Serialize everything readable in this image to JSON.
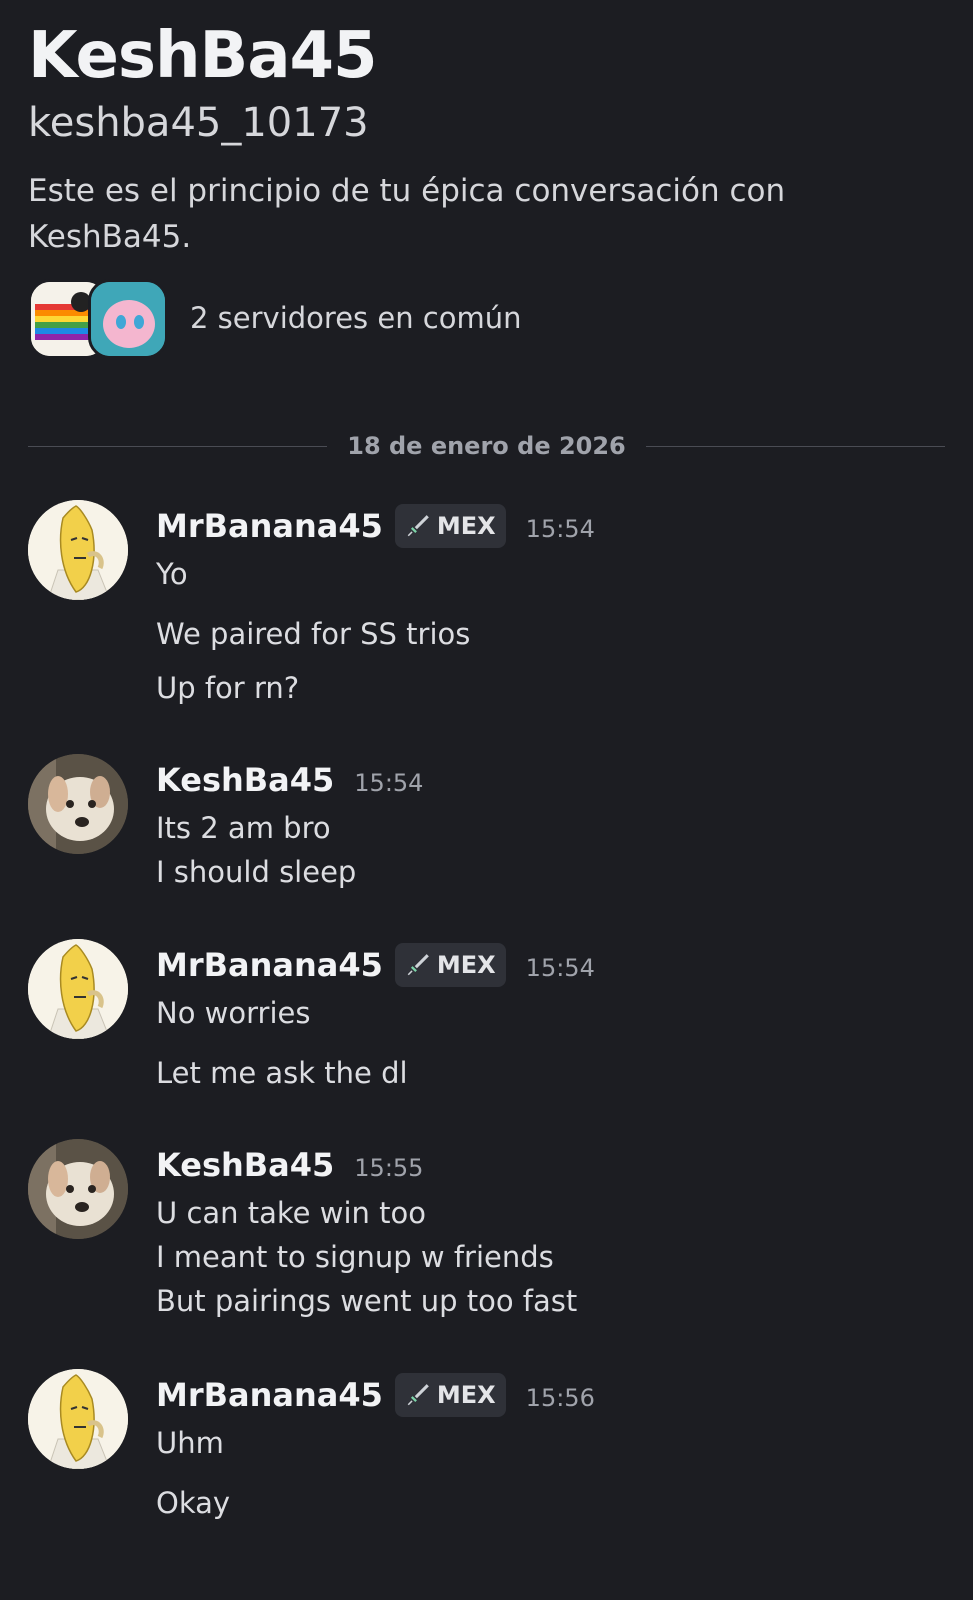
{
  "profile": {
    "display_name": "KeshBa45",
    "username": "keshba45_10173",
    "intro": "Este es el principio de tu épica conversación con KeshBa45.",
    "mutual_servers": "2 servidores en común"
  },
  "date_divider": "18 de enero de 2026",
  "tag_icon": "sword-icon",
  "messages": [
    {
      "author": "MrBanana45",
      "tag": "MEX",
      "time": "15:54",
      "lines": [
        "Yo",
        "We paired for SS trios",
        "Up for rn?"
      ]
    },
    {
      "author": "KeshBa45",
      "time": "15:54",
      "lines": [
        "Its 2 am bro",
        "I should sleep"
      ]
    },
    {
      "author": "MrBanana45",
      "tag": "MEX",
      "time": "15:54",
      "lines": [
        "No worries",
        "Let me ask the dl"
      ]
    },
    {
      "author": "KeshBa45",
      "time": "15:55",
      "lines": [
        "U can take win too",
        "I meant to signup w friends",
        "But pairings went up too fast"
      ]
    },
    {
      "author": "MrBanana45",
      "tag": "MEX",
      "time": "15:56",
      "lines": [
        "Uhm",
        "Okay"
      ]
    }
  ]
}
